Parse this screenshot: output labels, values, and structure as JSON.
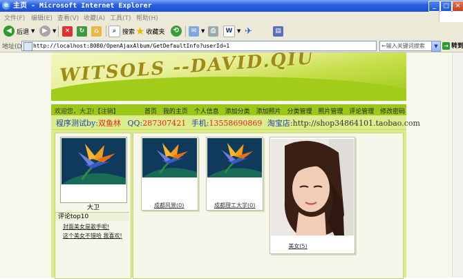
{
  "window": {
    "title": "主页 - Microsoft Internet Explorer",
    "controls": {
      "minimize": "_",
      "maximize": "□",
      "close": "✕"
    }
  },
  "menu": [
    "文件(F)",
    "编辑(E)",
    "查看(V)",
    "收藏(A)",
    "工具(T)",
    "帮助(H)"
  ],
  "toolbar": {
    "back": "后退",
    "search": "搜索",
    "favorites": "收藏夹"
  },
  "address": {
    "label": "地址(D)",
    "url": "http://localhost:8080/OpenAjaxAlbum/GetDefaultInfo?userId=1",
    "search_placeholder": "←输入关键词搜索",
    "go": "转到"
  },
  "site": {
    "banner_logo": "WITSOLS --DAVID.QIU",
    "welcome": "欢迎您，大卫!",
    "logout": "【注销】",
    "nav": [
      "首页",
      "我的主页",
      "个人信息",
      "添加分类",
      "添加照片",
      "分类管理",
      "照片管理",
      "评论管理",
      "修改密码"
    ],
    "info": {
      "tester_label": "程序测试by:",
      "tester_name": "双鱼林",
      "qq_label": "QQ:",
      "qq": "287307421",
      "phone_label": "手机:",
      "phone": "13558690869",
      "shop_label": "淘宝店:",
      "shop_url": "http://shop34864101.taobao.com"
    },
    "user": {
      "name": "大卫"
    },
    "comments": {
      "title": "评论top10",
      "items": [
        "封面美女是歌手呢!",
        "这个美女不错哈 我喜欢!"
      ]
    },
    "albums": [
      {
        "label": "成都风景(0)"
      },
      {
        "label": "成都理工大学(0)"
      },
      {
        "label": "美女(5)"
      }
    ]
  },
  "colors": {
    "titlebar": "#2b62e0",
    "banner_green": "#9cc817",
    "highlight_red": "#e62222",
    "link_blue": "#1a40b8"
  }
}
